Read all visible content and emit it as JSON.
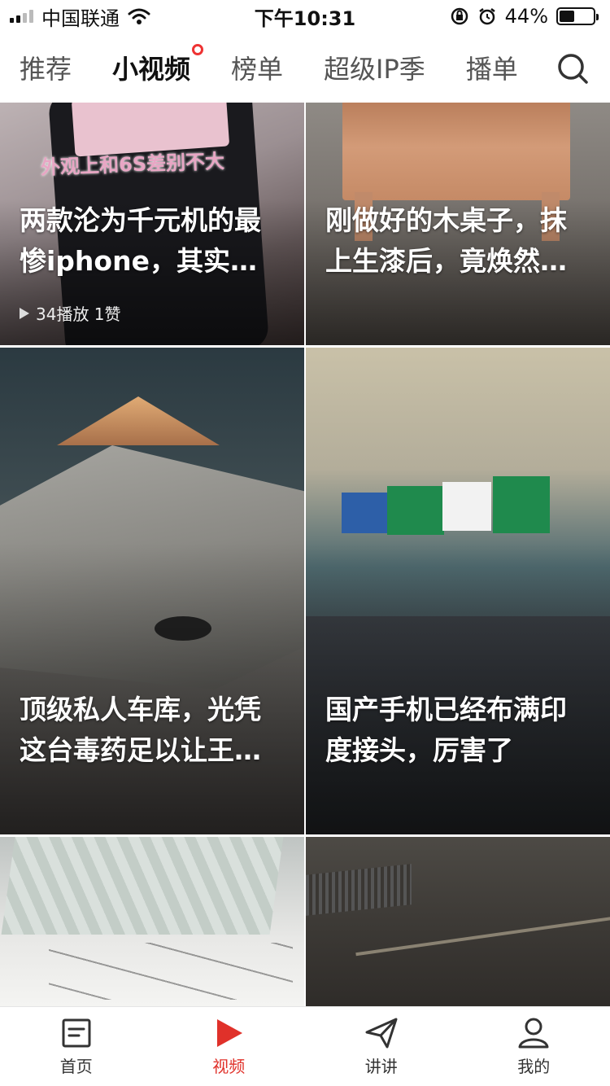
{
  "status_bar": {
    "carrier": "中国联通",
    "time": "下午10:31",
    "battery_percent": "44%",
    "battery_level": 0.44,
    "icons": [
      "signal-icon",
      "wifi-icon",
      "orientation-lock-icon",
      "alarm-icon",
      "battery-icon"
    ]
  },
  "top_tabs": {
    "items": [
      {
        "label": "推荐",
        "active": false
      },
      {
        "label": "小视频",
        "active": true,
        "badge": "dot"
      },
      {
        "label": "榜单",
        "active": false
      },
      {
        "label": "超级IP季",
        "active": false
      },
      {
        "label": "播单",
        "active": false
      }
    ],
    "search_icon": "search-icon"
  },
  "videos": [
    {
      "title": "两款沦为千元机的最惨iphone，其实…",
      "meta": "34播放 1赞",
      "overlay_text": "外观上和6S差别不大"
    },
    {
      "title": "刚做好的木桌子，抹上生漆后，竟焕然…",
      "meta": ""
    },
    {
      "title": "顶级私人车库，光凭这台毒药足以让王…",
      "meta": ""
    },
    {
      "title": "国产手机已经布满印度接头，厉害了",
      "meta": ""
    },
    {
      "title": "",
      "meta": ""
    },
    {
      "title": "",
      "meta": ""
    }
  ],
  "bottom_nav": {
    "items": [
      {
        "label": "首页",
        "icon": "news-icon",
        "active": false
      },
      {
        "label": "视频",
        "icon": "play-icon",
        "active": true
      },
      {
        "label": "讲讲",
        "icon": "send-icon",
        "active": false
      },
      {
        "label": "我的",
        "icon": "profile-icon",
        "active": false
      }
    ]
  },
  "colors": {
    "accent": "#e0312a",
    "tab_active": "#111111",
    "tab_inactive": "#555555"
  }
}
